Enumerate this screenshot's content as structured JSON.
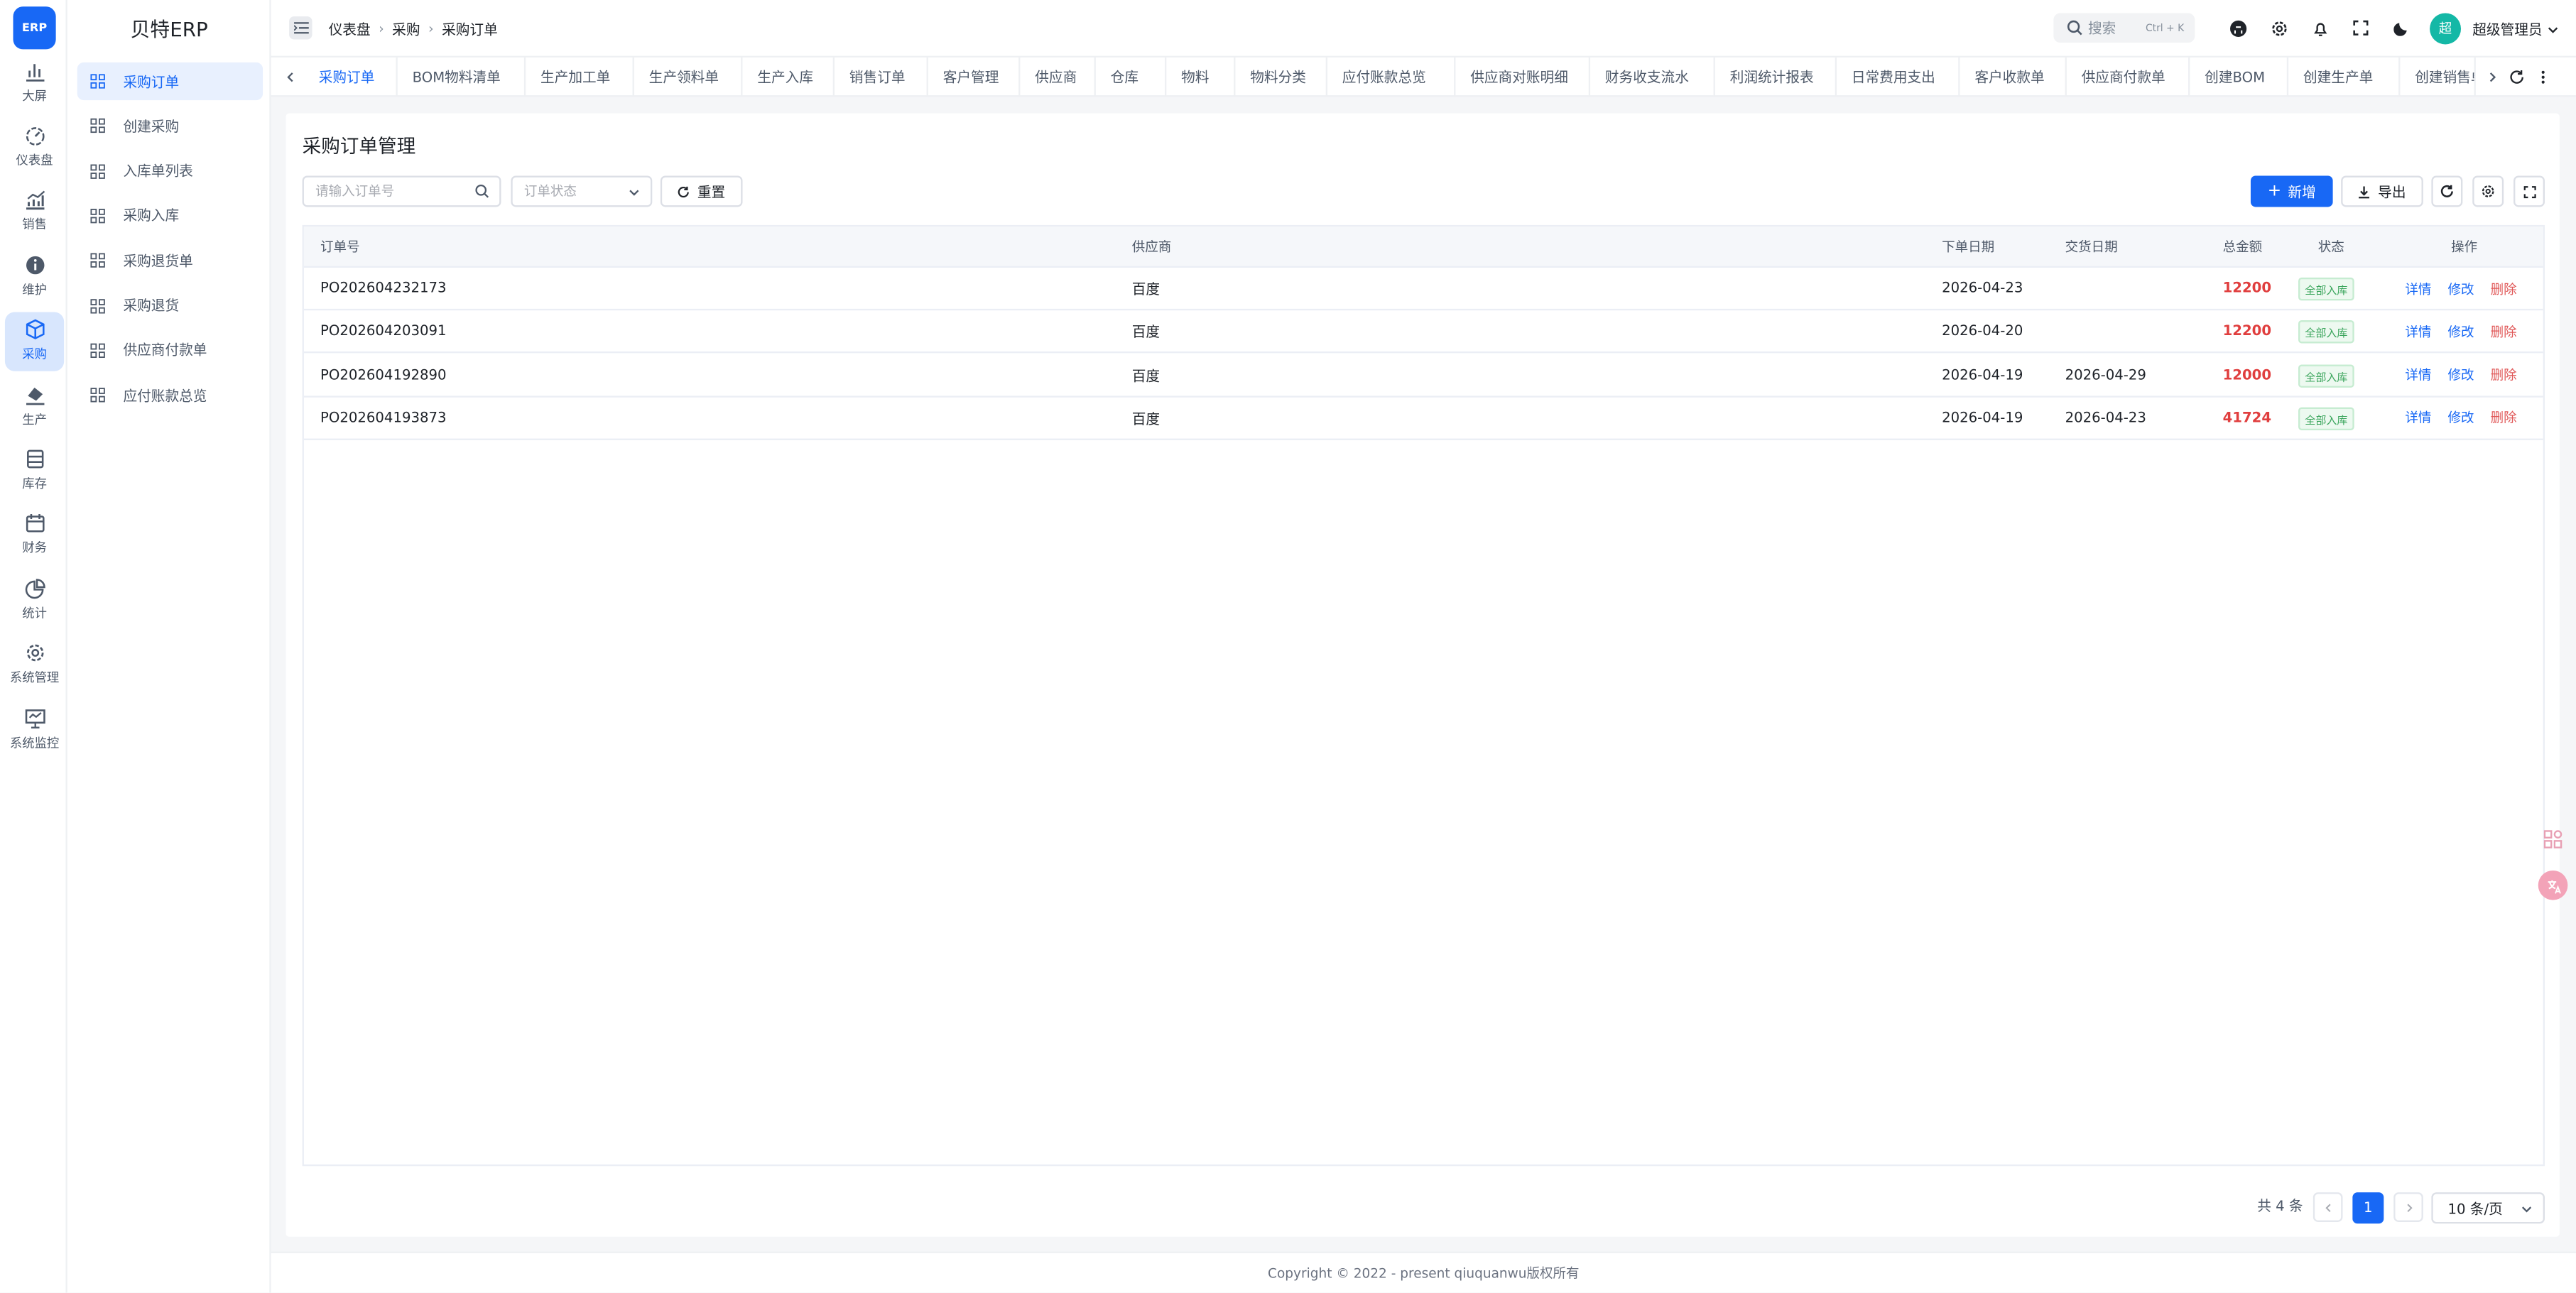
{
  "app": {
    "logo_text": "ERP",
    "brand": "贝特ERP"
  },
  "rail": [
    {
      "label": "大屏",
      "icon": "bar-chart-icon"
    },
    {
      "label": "仪表盘",
      "icon": "dashboard-gauge-icon"
    },
    {
      "label": "销售",
      "icon": "trend-chart-icon"
    },
    {
      "label": "维护",
      "icon": "info-icon"
    },
    {
      "label": "采购",
      "icon": "cube-icon",
      "active": true
    },
    {
      "label": "生产",
      "icon": "paint-bucket-icon"
    },
    {
      "label": "库存",
      "icon": "database-icon"
    },
    {
      "label": "财务",
      "icon": "calendar-icon"
    },
    {
      "label": "统计",
      "icon": "pie-chart-icon"
    },
    {
      "label": "系统管理",
      "icon": "gear-icon"
    },
    {
      "label": "系统监控",
      "icon": "monitor-icon"
    }
  ],
  "submenu": [
    {
      "label": "采购订单",
      "active": true
    },
    {
      "label": "创建采购"
    },
    {
      "label": "入库单列表"
    },
    {
      "label": "采购入库"
    },
    {
      "label": "采购退货单"
    },
    {
      "label": "采购退货"
    },
    {
      "label": "供应商付款单"
    },
    {
      "label": "应付账款总览"
    }
  ],
  "breadcrumb": [
    "仪表盘",
    "采购",
    "采购订单"
  ],
  "header": {
    "search_placeholder": "搜索",
    "search_shortcut": "Ctrl + K",
    "avatar_text": "超",
    "user_name": "超级管理员"
  },
  "tabs": [
    "采购订单",
    "BOM物料清单",
    "生产加工单",
    "生产领料单",
    "生产入库",
    "销售订单",
    "客户管理",
    "供应商",
    "仓库",
    "物料",
    "物料分类",
    "应付账款总览",
    "供应商对账明细",
    "财务收支流水",
    "利润统计报表",
    "日常费用支出",
    "客户收款单",
    "供应商付款单",
    "创建BOM",
    "创建生产单",
    "创建销售单"
  ],
  "page": {
    "title": "采购订单管理",
    "order_no_placeholder": "请输入订单号",
    "status_placeholder": "订单状态",
    "reset_label": "重置",
    "add_label": "新增",
    "export_label": "导出"
  },
  "table": {
    "columns": [
      "订单号",
      "供应商",
      "下单日期",
      "交货日期",
      "总金额",
      "状态",
      "操作"
    ],
    "rows": [
      {
        "order_no": "PO202604232173",
        "supplier": "百度",
        "order_date": "2026-04-23",
        "delivery_date": "",
        "amount": "12200",
        "status": "全部入库"
      },
      {
        "order_no": "PO202604203091",
        "supplier": "百度",
        "order_date": "2026-04-20",
        "delivery_date": "",
        "amount": "12200",
        "status": "全部入库"
      },
      {
        "order_no": "PO202604192890",
        "supplier": "百度",
        "order_date": "2026-04-19",
        "delivery_date": "2026-04-29",
        "amount": "12000",
        "status": "全部入库"
      },
      {
        "order_no": "PO202604193873",
        "supplier": "百度",
        "order_date": "2026-04-19",
        "delivery_date": "2026-04-23",
        "amount": "41724",
        "status": "全部入库"
      }
    ],
    "actions": {
      "detail": "详情",
      "edit": "修改",
      "delete": "删除"
    }
  },
  "pagination": {
    "total_label": "共 4 条",
    "current_page": "1",
    "page_size": "10 条/页"
  },
  "footer": {
    "copyright": "Copyright © 2022 - present qiuquanwu版权所有"
  },
  "colors": {
    "primary": "#1868f5",
    "amount": "#e03e3e",
    "status_ok": "#3ba55c"
  }
}
